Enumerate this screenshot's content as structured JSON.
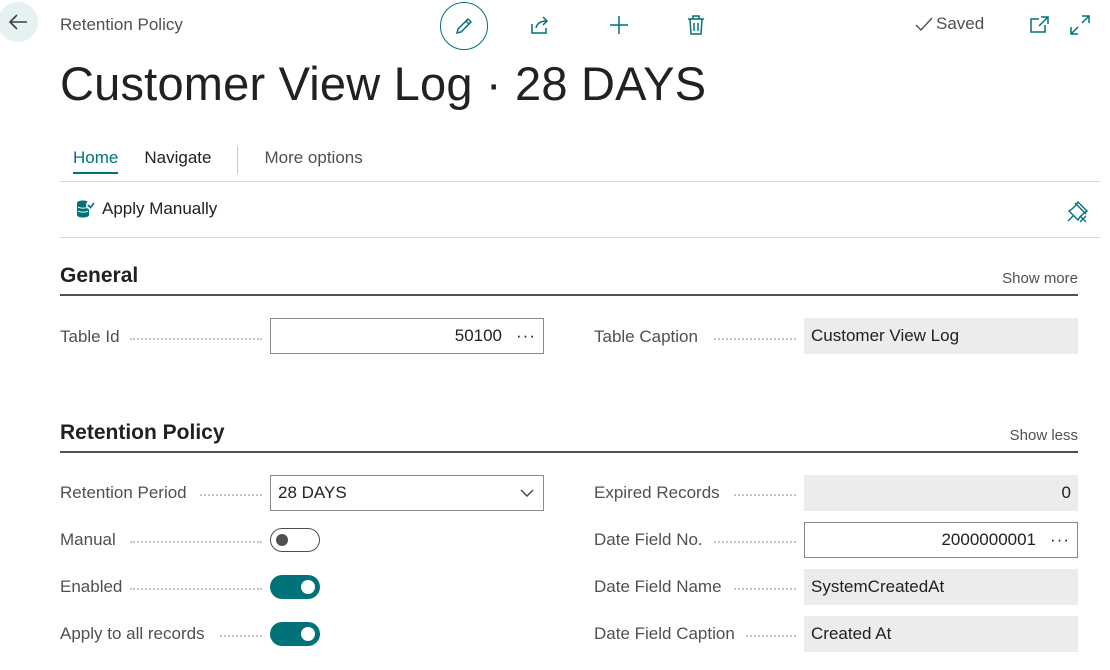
{
  "header": {
    "breadcrumb": "Retention Policy",
    "title": "Customer View Log · 28 DAYS",
    "status": "Saved"
  },
  "tabs": [
    {
      "label": "Home"
    },
    {
      "label": "Navigate"
    },
    {
      "label": "More options"
    }
  ],
  "actions": {
    "apply_manually": "Apply Manually"
  },
  "sections": {
    "general": {
      "title": "General",
      "toggle": "Show more",
      "table_id_label": "Table Id",
      "table_id_value": "50100",
      "table_caption_label": "Table Caption",
      "table_caption_value": "Customer View Log"
    },
    "retention": {
      "title": "Retention Policy",
      "toggle": "Show less",
      "retention_period_label": "Retention Period",
      "retention_period_value": "28 DAYS",
      "manual_label": "Manual",
      "manual_value": false,
      "enabled_label": "Enabled",
      "enabled_value": true,
      "apply_all_label": "Apply to all records",
      "apply_all_value": true,
      "expired_records_label": "Expired Records",
      "expired_records_value": "0",
      "date_field_no_label": "Date Field No.",
      "date_field_no_value": "2000000001",
      "date_field_name_label": "Date Field Name",
      "date_field_name_value": "SystemCreatedAt",
      "date_field_caption_label": "Date Field Caption",
      "date_field_caption_value": "Created At"
    }
  },
  "misc": {
    "lookup_ellipsis": "···"
  },
  "colors": {
    "accent": "#00727a",
    "readonly_bg": "#ececec"
  },
  "icons": [
    "back-arrow-icon",
    "pencil-icon",
    "share-icon",
    "plus-icon",
    "trash-icon",
    "checkmark-icon",
    "open-new-window-icon",
    "expand-icon",
    "apply-manually-icon",
    "pin-icon",
    "chevron-down-icon"
  ]
}
